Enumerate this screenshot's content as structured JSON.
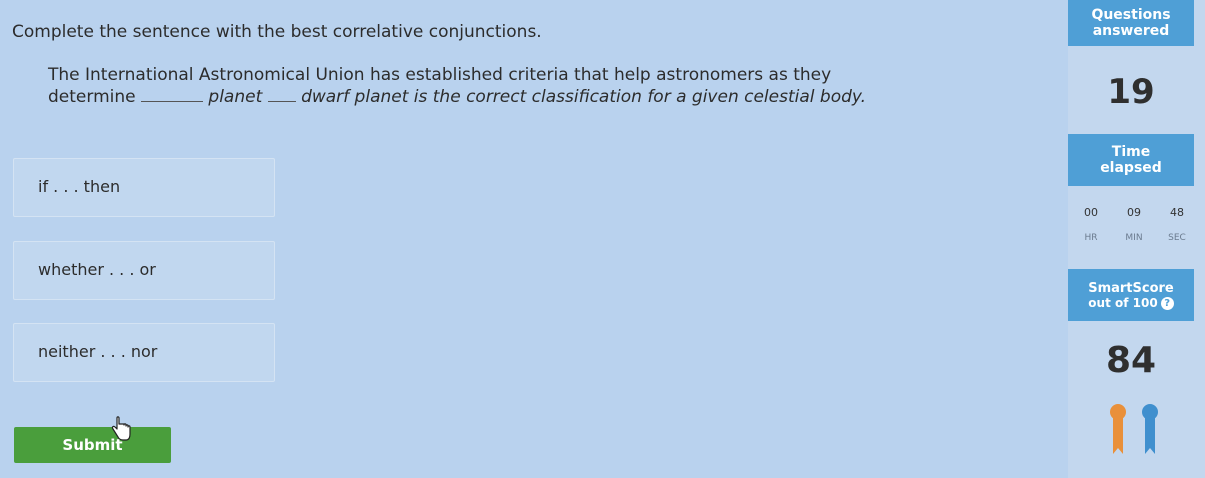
{
  "instruction": "Complete the sentence with the best correlative conjunctions.",
  "question": {
    "part1": "The International Astronomical Union has established criteria that help astronomers as they determine",
    "part2": "planet",
    "part3": "dwarf planet is the correct classification for a given celestial body."
  },
  "options": [
    {
      "label": "if . . . then"
    },
    {
      "label": "whether . . . or"
    },
    {
      "label": "neither . . . nor"
    }
  ],
  "submit_label": "Submit",
  "sidebar": {
    "questions_title": "Questions",
    "questions_sub": "answered",
    "questions_answered": "19",
    "time_title": "Time",
    "time_sub": "elapsed",
    "timer": [
      {
        "value": "00",
        "unit": "HR"
      },
      {
        "value": "09",
        "unit": "MIN"
      },
      {
        "value": "48",
        "unit": "SEC"
      }
    ],
    "smartscore_title": "SmartScore",
    "smartscore_sub": "out of 100",
    "smartscore_value": "84"
  },
  "colors": {
    "background": "#b9d2ee",
    "sidebar_header": "#4f9fd6",
    "submit": "#4a9e3c",
    "award_orange": "#e9903a",
    "award_blue": "#3f8fce"
  }
}
